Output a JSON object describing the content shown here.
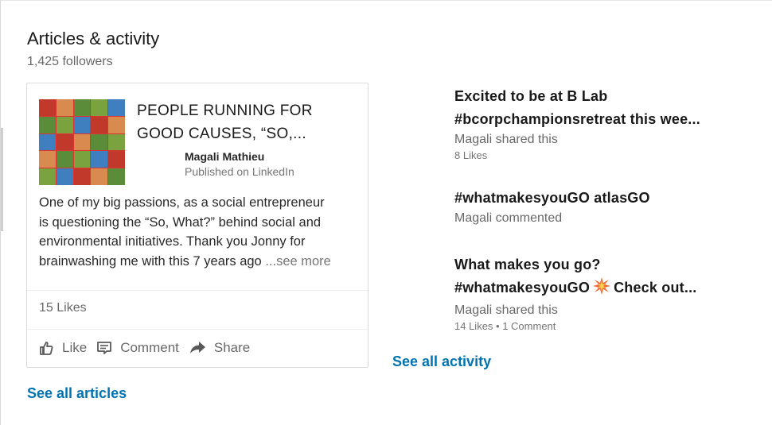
{
  "section": {
    "title": "Articles & activity",
    "followers": "1,425 followers"
  },
  "article": {
    "title_line1": "PEOPLE RUNNING FOR",
    "title_line2": "GOOD CAUSES, “SO,...",
    "author": "Magali Mathieu",
    "published": "Published on LinkedIn",
    "excerpt_lines": [
      "One of my big passions, as a social entrepreneur",
      "is questioning the “So, What?” behind social and",
      "environmental initiatives. Thank you Jonny for",
      "brainwashing me with this 7 years ago "
    ],
    "see_more": " ...see more",
    "likes": "15 Likes",
    "actions": {
      "like": "Like",
      "comment": "Comment",
      "share": "Share"
    },
    "thumbnail_colors": [
      "#c0392b",
      "#5b8c3a",
      "#3f7fbf",
      "#d98a4e",
      "#7aa23f"
    ]
  },
  "activity": [
    {
      "title_line1": "Excited to be at B Lab",
      "title_line2": "#bcorpchampionsretreat this wee...",
      "meta": "Magali shared this",
      "stats": "8 Likes"
    },
    {
      "title_line1": "#whatmakesyouGO atlasGO",
      "meta": "Magali commented"
    },
    {
      "title_line1": "What makes you go?",
      "title_line2_pre": "#whatmakesyouGO",
      "emoji_icon": "collision-emoji-icon",
      "title_line2_post": "Check out...",
      "meta": "Magali shared this",
      "stats": "14 Likes • 1 Comment"
    }
  ],
  "links": {
    "see_all_activity": "See all activity",
    "see_all_articles": "See all articles"
  },
  "colors": {
    "link": "#0073b1",
    "text_primary": "rgba(0,0,0,0.9)",
    "text_secondary": "rgba(0,0,0,0.6)"
  }
}
